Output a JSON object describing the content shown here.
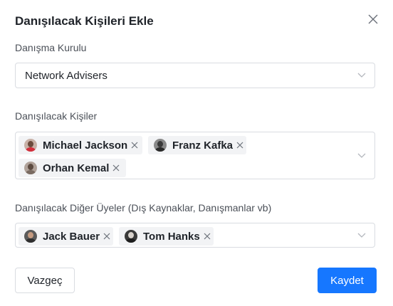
{
  "dialog": {
    "title": "Danışılacak Kişileri Ekle",
    "close_icon": "close-icon"
  },
  "board_field": {
    "label": "Danışma Kurulu",
    "value": "Network Advisers"
  },
  "people_field": {
    "label": "Danışılacak Kişiler",
    "tags": [
      "Michael Jackson",
      "Franz Kafka",
      "Orhan Kemal"
    ]
  },
  "others_field": {
    "label": "Danışılacak Diğer Üyeler (Dış Kaynaklar, Danışmanlar vb)",
    "tags": [
      "Jack Bauer",
      "Tom Hanks"
    ]
  },
  "actions": {
    "cancel_label": "Vazgeç",
    "save_label": "Kaydet"
  },
  "colors": {
    "primary": "#1677ff",
    "tag_bg": "#f2f3f5",
    "border": "#d9dce1"
  }
}
